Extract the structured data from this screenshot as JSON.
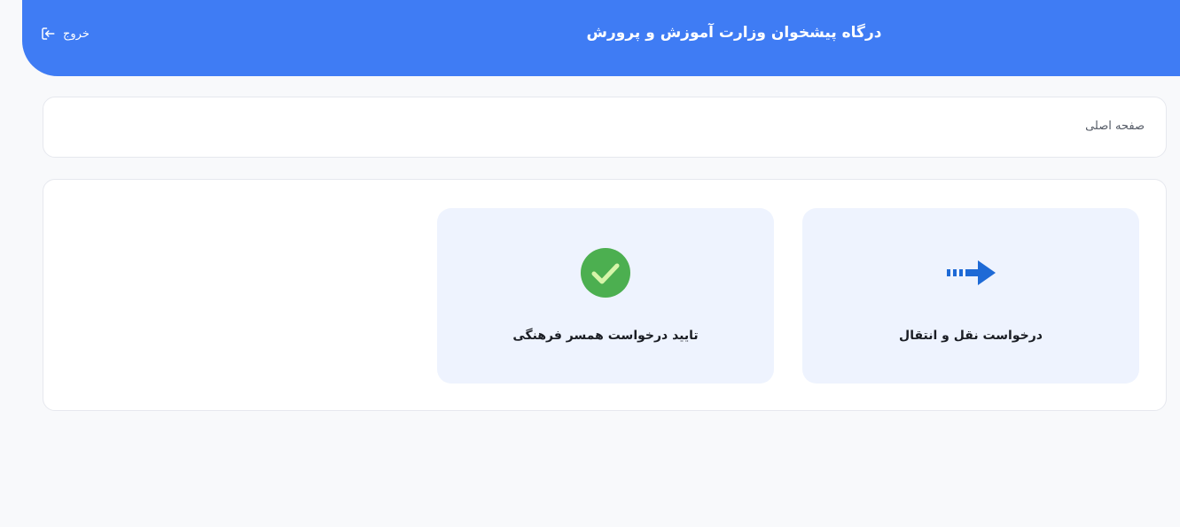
{
  "header": {
    "title": "درگاه پیشخوان وزارت آموزش و پرورش",
    "logout_label": "خروج",
    "logout_icon": "logout-icon",
    "bg_color": "#3f7cf4"
  },
  "breadcrumb": {
    "label": "صفحه اصلی"
  },
  "tiles": [
    {
      "label": "درخواست نقل و انتقال",
      "icon": "arrow-right-icon",
      "icon_color": "#1e6ad6"
    },
    {
      "label": "تایید درخواست همسر فرهنگی",
      "icon": "check-circle-icon",
      "icon_color": "#4caf50"
    }
  ]
}
